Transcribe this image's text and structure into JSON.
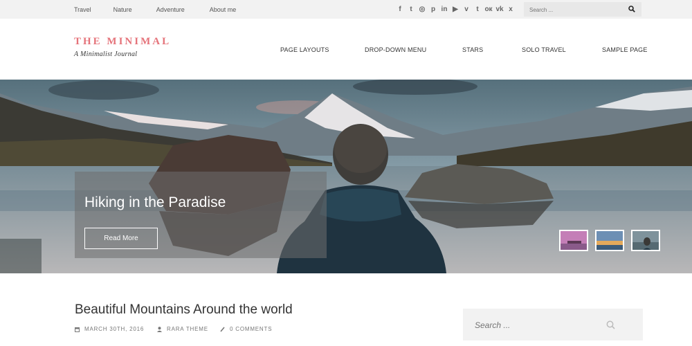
{
  "topbar": {
    "links": [
      "Travel",
      "Nature",
      "Adventure",
      "About me"
    ],
    "social_icons": [
      "f",
      "twitter-icon",
      "instagram-icon",
      "pinterest-icon",
      "linkedin-icon",
      "youtube-icon",
      "vimeo-icon",
      "tumblr-icon",
      "odnoklassniki-icon",
      "vk-icon",
      "xing-icon"
    ],
    "social_glyphs": [
      "f",
      "t",
      "◎",
      "p",
      "in",
      "▶",
      "v",
      "t",
      "ок",
      "vk",
      "x"
    ],
    "search_placeholder": "Search ..."
  },
  "header": {
    "site_title": "THE MINIMAL",
    "tagline": "A Minimalist Journal",
    "nav": [
      "PAGE LAYOUTS",
      "DROP-DOWN MENU",
      "STARS",
      "SOLO TRAVEL",
      "SAMPLE PAGE"
    ],
    "title_color": "#e5737a"
  },
  "hero": {
    "title": "Hiking in the Paradise",
    "button": "Read More"
  },
  "post": {
    "title": "Beautiful Mountains Around the world",
    "date": "MARCH 30TH, 2016",
    "author": "RARA THEME",
    "comments": "0 COMMENTS"
  },
  "sidebar": {
    "search_placeholder": "Search ..."
  }
}
